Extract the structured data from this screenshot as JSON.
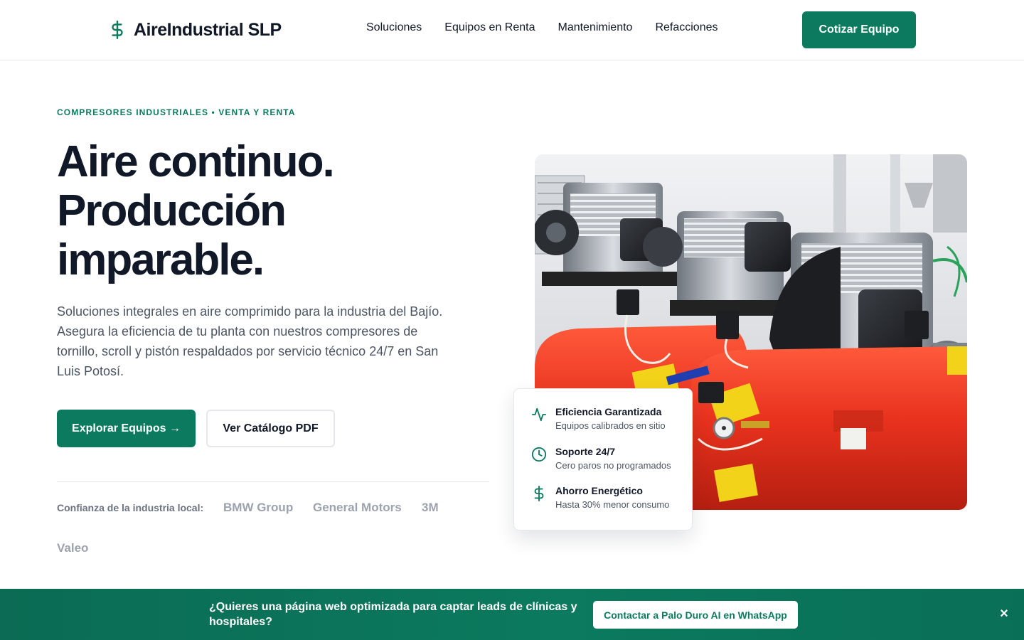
{
  "header": {
    "logo_text": "AireIndustrial SLP",
    "logo_icon": "dollar-sign-icon",
    "nav": [
      {
        "label": "Soluciones"
      },
      {
        "label": "Equipos en Renta"
      },
      {
        "label": "Mantenimiento"
      },
      {
        "label": "Refacciones"
      }
    ],
    "cta_label": "Cotizar Equipo"
  },
  "hero": {
    "eyebrow": "COMPRESORES INDUSTRIALES • VENTA Y RENTA",
    "headline_lines": [
      "Aire continuo.",
      "Producción",
      "imparable."
    ],
    "lead": "Soluciones integrales en aire comprimido para la industria del Bajío. Asegura la eficiencia de tu planta con nuestros compresores de tornillo, scroll y pistón respaldados por servicio técnico 24/7 en San Luis Potosí.",
    "primary_button": "Explorar Equipos →",
    "secondary_button": "Ver Catálogo PDF",
    "trust_label": "Confianza de la industria local:",
    "brands": [
      "BMW Group",
      "General Motors",
      "3M",
      "Valeo"
    ]
  },
  "features": [
    {
      "icon": "activity-icon",
      "title": "Eficiencia Garantizada",
      "subtitle": "Equipos calibrados en sitio"
    },
    {
      "icon": "clock-icon",
      "title": "Soporte 24/7",
      "subtitle": "Cero paros no programados"
    },
    {
      "icon": "dollar-sign-icon",
      "title": "Ahorro Energético",
      "subtitle": "Hasta 30% menor consumo"
    }
  ],
  "banner": {
    "text": "¿Quieres una página web optimizada para captar leads de clínicas y hospitales?",
    "button": "Contactar a Palo Duro AI en WhatsApp",
    "close": "×"
  },
  "colors": {
    "brand_green": "#0b7a5e",
    "text_dark": "#111827",
    "text_muted": "#4b5563",
    "brand_gray": "#9ca3af",
    "compressor_red": "#e8321e"
  }
}
